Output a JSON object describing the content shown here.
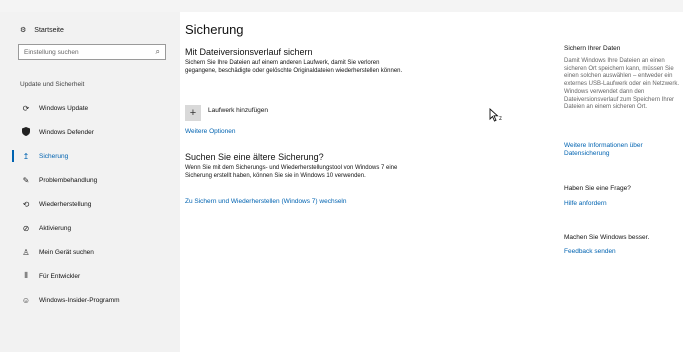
{
  "sidebar": {
    "home_label": "Startseite",
    "search_placeholder": "Einstellung suchen",
    "section_label": "Update und Sicherheit",
    "items": [
      {
        "label": "Windows Update",
        "icon": "refresh-icon"
      },
      {
        "label": "Windows Defender",
        "icon": "shield-icon"
      },
      {
        "label": "Sicherung",
        "icon": "backup-arrow-icon",
        "active": true
      },
      {
        "label": "Problembehandlung",
        "icon": "wrench-icon"
      },
      {
        "label": "Wiederherstellung",
        "icon": "history-icon"
      },
      {
        "label": "Aktivierung",
        "icon": "check-circle-icon"
      },
      {
        "label": "Mein Gerät suchen",
        "icon": "person-locate-icon"
      },
      {
        "label": "Für Entwickler",
        "icon": "developer-tools-icon"
      },
      {
        "label": "Windows-Insider-Programm",
        "icon": "insider-smile-icon"
      }
    ]
  },
  "main": {
    "title": "Sicherung",
    "file_history": {
      "heading": "Mit Dateiversionsverlauf sichern",
      "description": "Sichern Sie Ihre Dateien auf einem anderen Laufwerk, damit Sie verloren gegangene, beschädigte oder gelöschte Originaldateien wiederherstellen können.",
      "add_drive_label": "Laufwerk hinzufügen",
      "more_options": "Weitere Optionen"
    },
    "older_backup": {
      "heading": "Suchen Sie eine ältere Sicherung?",
      "description": "Wenn Sie mit dem Sicherungs- und Wiederherstellungstool von Windows 7 eine Sicherung erstellt haben, können Sie sie in Windows 10 verwenden.",
      "link": "Zu Sichern und Wiederherstellen (Windows 7) wechseln"
    }
  },
  "right_panel": {
    "secure_heading": "Sichern Ihrer Daten",
    "secure_text": "Damit Windows Ihre Dateien an einen sicheren Ort speichern kann, müssen Sie einen solchen auswählen – entweder ein externes USB-Laufwerk oder ein Netzwerk. Windows verwendet dann den Dateiversionsverlauf zum Speichern Ihrer Dateien an einem sicheren Ort.",
    "secure_link": "Weitere Informationen über Datensicherung",
    "question_heading": "Haben Sie eine Frage?",
    "question_link": "Hilfe anfordern",
    "feedback_heading": "Machen Sie Windows besser.",
    "feedback_link": "Feedback senden"
  },
  "colors": {
    "accent": "#0063b1",
    "sidebar_bg": "#f2f2f2"
  }
}
